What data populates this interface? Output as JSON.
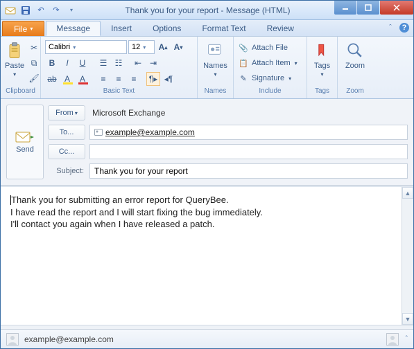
{
  "window": {
    "title": "Thank you for your report  -  Message (HTML)"
  },
  "tabs": {
    "file": "File",
    "items": [
      "Message",
      "Insert",
      "Options",
      "Format Text",
      "Review"
    ],
    "active_index": 0
  },
  "ribbon": {
    "clipboard": {
      "paste": "Paste",
      "label": "Clipboard"
    },
    "basic_text": {
      "font_name": "Calibri",
      "font_size": "12",
      "label": "Basic Text"
    },
    "names": {
      "names": "Names",
      "label": "Names"
    },
    "include": {
      "attach_file": "Attach File",
      "attach_item": "Attach Item",
      "signature": "Signature",
      "label": "Include"
    },
    "tags": {
      "tags": "Tags",
      "label": "Tags"
    },
    "zoom": {
      "zoom": "Zoom",
      "label": "Zoom"
    }
  },
  "compose": {
    "send": "Send",
    "from_btn": "From",
    "from_value": "Microsoft Exchange",
    "to_btn": "To...",
    "to_value": "example@example.com",
    "cc_btn": "Cc...",
    "cc_value": "",
    "subject_label": "Subject:",
    "subject_value": "Thank you for your report"
  },
  "body": {
    "line1": "Thank you for submitting an error report for QueryBee.",
    "line2": "I have read the report and I will start fixing the bug immediately.",
    "line3": "I'll contact you again when I have released a patch."
  },
  "status": {
    "account": "example@example.com"
  }
}
